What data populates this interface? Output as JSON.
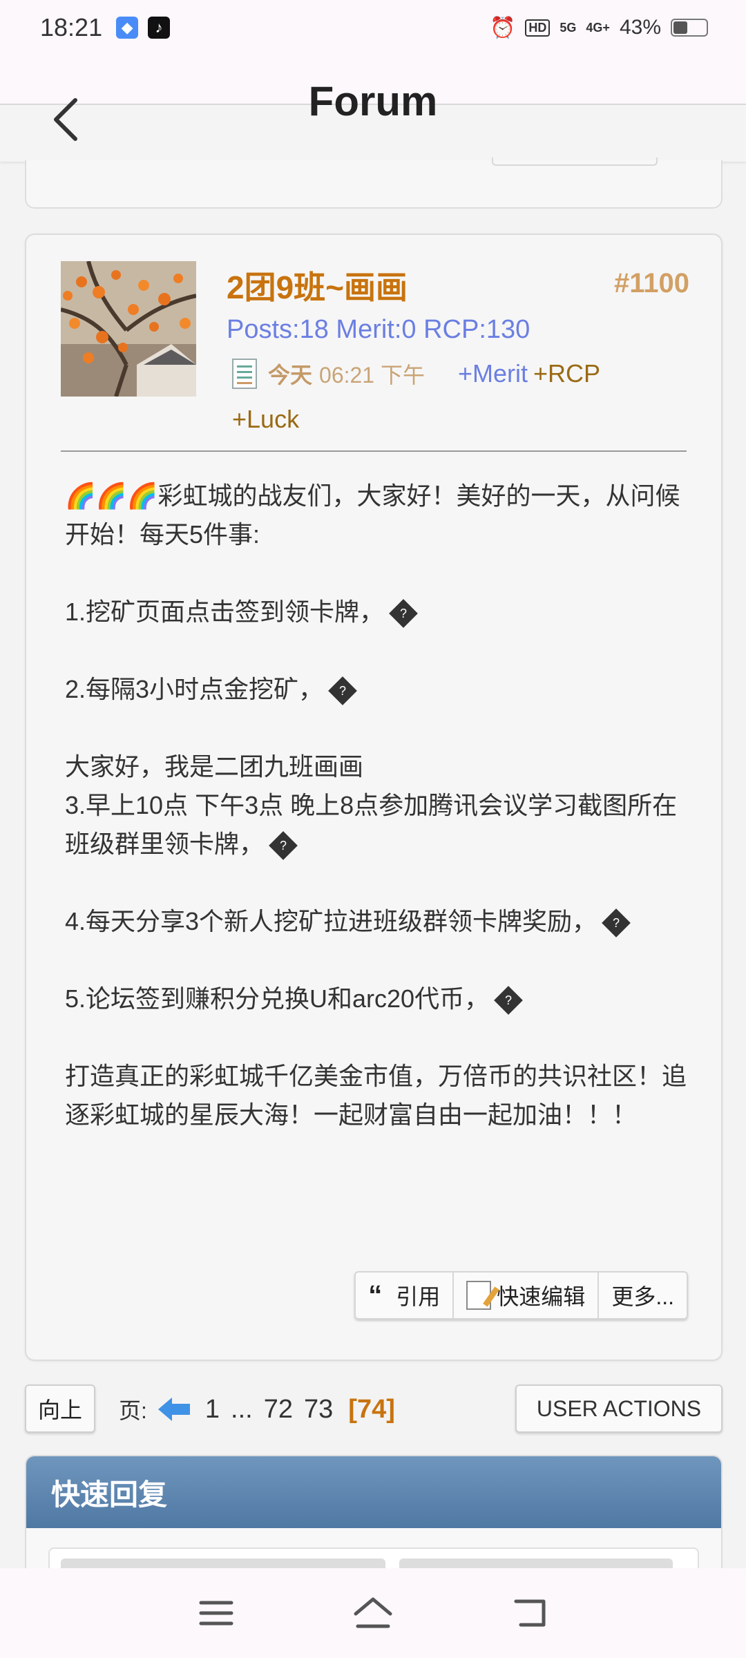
{
  "status_bar": {
    "time": "18:21",
    "network_badge": "HD",
    "signal_1": "5G",
    "signal_2": "4G+",
    "battery": "43%"
  },
  "header": {
    "title": "Forum"
  },
  "post": {
    "username": "2团9班~画画",
    "post_number": "#1100",
    "stats": "Posts:18 Merit:0  RCP:130",
    "date_today": "今天",
    "date_time": "06:21 下午",
    "plus_merit": "+Merit",
    "plus_rcp": "+RCP",
    "plus_luck": "+Luck",
    "body": {
      "intro": "🌈🌈🌈彩虹城的战友们，大家好！美好的一天，从问候开始！每天5件事:",
      "item1": "1.挖矿页面点击签到领卡牌，",
      "item2": "2.每隔3小时点金挖矿，",
      "greeting": "大家好，我是二团九班画画",
      "item3": "3.早上10点 下午3点 晚上8点参加腾讯会议学习截图所在班级群里领卡牌，",
      "item4": "4.每天分享3个新人挖矿拉进班级群领卡牌奖励，",
      "item5": "5.论坛签到赚积分兑换U和arc20代币，",
      "closing": "打造真正的彩虹城千亿美金市值，万倍币的共识社区！追逐彩虹城的星辰大海！一起财富自由一起加油！！！"
    },
    "actions": {
      "quote": "引用",
      "quick_edit": "快速编辑",
      "more": "更多..."
    }
  },
  "pagination": {
    "up_label": "向上",
    "page_label": "页:",
    "pages": [
      "1",
      "...",
      "72",
      "73"
    ],
    "current": "[74]",
    "user_actions": "USER ACTIONS"
  },
  "quick_reply": {
    "title": "快速回复"
  }
}
